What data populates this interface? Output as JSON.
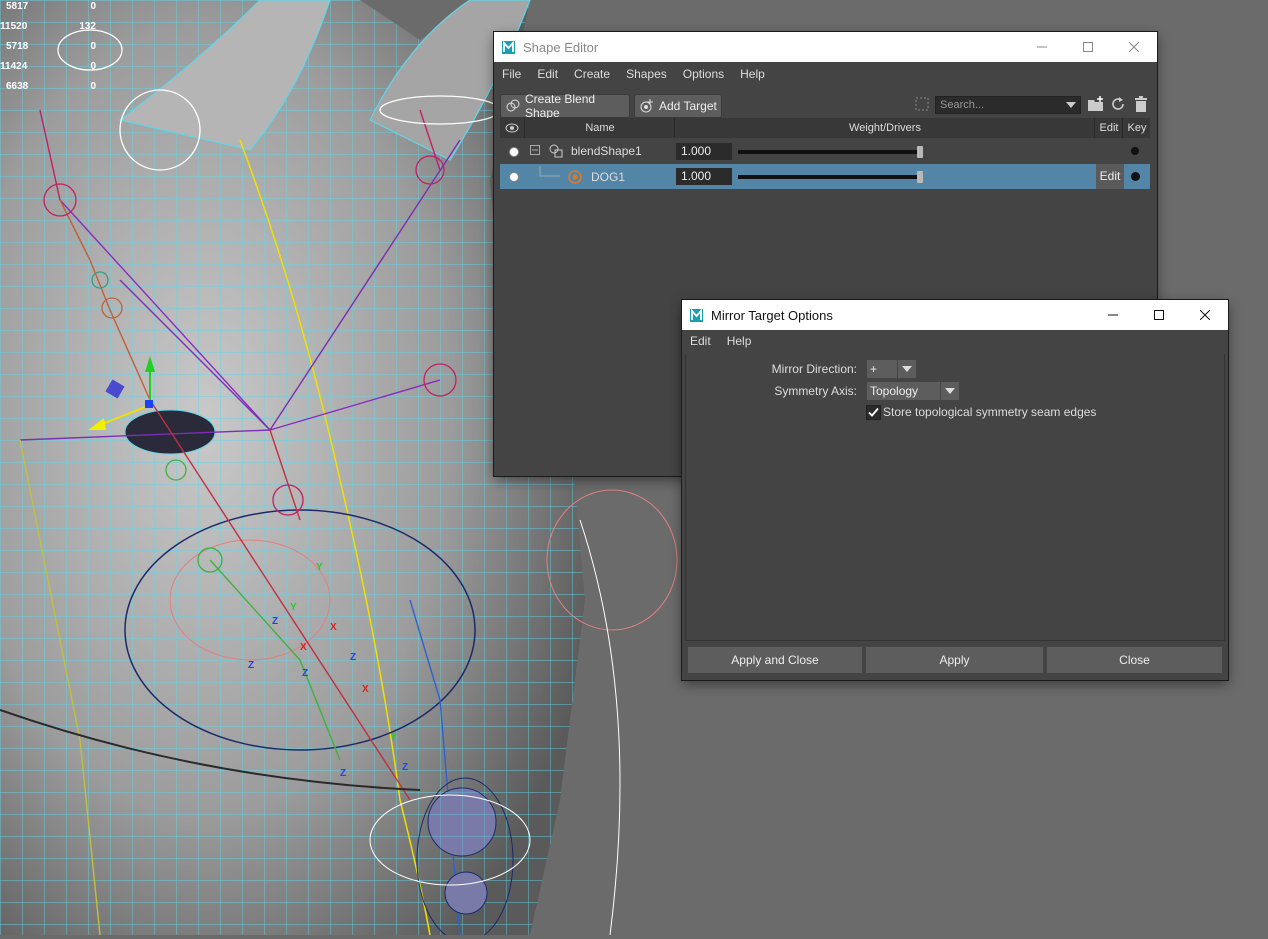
{
  "hud": [
    {
      "a": "5817",
      "b": "0"
    },
    {
      "a": "11520",
      "b": "132"
    },
    {
      "a": "5718",
      "b": "0"
    },
    {
      "a": "11424",
      "b": "0"
    },
    {
      "a": "6638",
      "b": "0"
    }
  ],
  "viewport_labels": [
    "Z",
    "Y",
    "X",
    "Z",
    "Y",
    "Z",
    "Z",
    "X",
    "Y",
    "Z",
    "X",
    "Z"
  ],
  "shape_editor": {
    "title": "Shape Editor",
    "menu": [
      "File",
      "Edit",
      "Create",
      "Shapes",
      "Options",
      "Help"
    ],
    "toolbar": {
      "create_blend_shape": "Create Blend Shape",
      "add_target": "Add Target",
      "search_placeholder": "Search..."
    },
    "columns": {
      "name": "Name",
      "weight": "Weight/Drivers",
      "edit": "Edit",
      "key": "Key"
    },
    "rows": [
      {
        "name": "blendShape1",
        "weight": "1.000",
        "slider": 1.0,
        "selected": false,
        "edit": ""
      },
      {
        "name": "DOG1",
        "weight": "1.000",
        "slider": 1.0,
        "selected": true,
        "edit": "Edit"
      }
    ]
  },
  "mirror": {
    "title": "Mirror Target Options",
    "menu": [
      "Edit",
      "Help"
    ],
    "direction_label": "Mirror Direction:",
    "direction_value": "+",
    "axis_label": "Symmetry Axis:",
    "axis_value": "Topology",
    "seam_label": "Store topological symmetry seam edges",
    "seam_checked": true,
    "buttons": {
      "apply_close": "Apply and Close",
      "apply": "Apply",
      "close": "Close"
    }
  },
  "colors": {
    "selection": "#5285a6",
    "panel": "#444444",
    "wire": "#5fd6ea"
  }
}
